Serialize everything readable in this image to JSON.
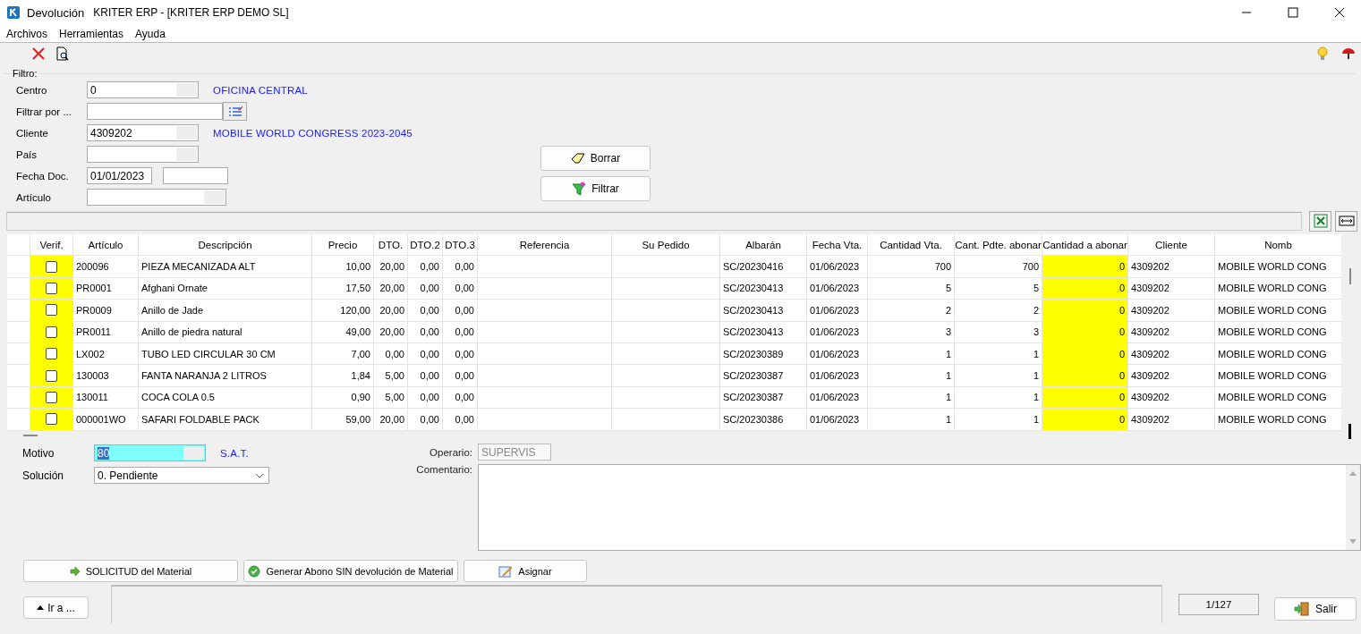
{
  "window": {
    "title": "Devolución",
    "app": "KRITER ERP -  [KRITER ERP DEMO SL]"
  },
  "menu": [
    "Archivos",
    "Herramientas",
    "Ayuda"
  ],
  "filter": {
    "title": "Filtro:",
    "fields": [
      {
        "label": "Centro",
        "kind": "lookup",
        "value": "0",
        "description": "OFICINA CENTRAL"
      },
      {
        "label": "Filtrar por ...",
        "kind": "list"
      },
      {
        "label": "Cliente",
        "kind": "lookup",
        "value": "4309202",
        "description": "MOBILE WORLD CONGRESS 2023-2045"
      },
      {
        "label": "País",
        "kind": "lookup"
      },
      {
        "label": "Fecha Doc.",
        "kind": "range",
        "value": "01/01/2023"
      },
      {
        "label": "Artículo",
        "kind": "lookup_wide"
      }
    ],
    "buttons": [
      "Borrar",
      "Filtrar"
    ]
  },
  "table": {
    "check_column": {
      "label": "Verif."
    },
    "columns": [
      {
        "label": "Artículo",
        "kind": "text"
      },
      {
        "label": "Descripción",
        "kind": "text"
      },
      {
        "label": "Precio",
        "kind": "number"
      },
      {
        "label": "DTO.",
        "kind": "number"
      },
      {
        "label": "DTO.2",
        "kind": "number"
      },
      {
        "label": "DTO.3",
        "kind": "number"
      },
      {
        "label": "Referencia",
        "kind": "text"
      },
      {
        "label": "Su Pedido",
        "kind": "text"
      },
      {
        "label": "Albarán",
        "kind": "text"
      },
      {
        "label": "Fecha Vta.",
        "kind": "text"
      },
      {
        "label": "Cantidad Vta.",
        "kind": "number"
      },
      {
        "label": "Cant. Pdte. abonar",
        "kind": "number"
      },
      {
        "label": "Cantidad a abonar",
        "kind": "editable"
      },
      {
        "label": "Cliente",
        "kind": "text"
      },
      {
        "label": "Nomb",
        "kind": "text"
      }
    ],
    "rows": [
      {
        "checked": false,
        "cells": [
          "200096",
          "PIEZA MECANIZADA ALT",
          "10,00",
          "20,00",
          "0,00",
          "0,00",
          "",
          "",
          "SC/20230416",
          "01/06/2023",
          "700",
          "700",
          "0",
          "4309202",
          "MOBILE WORLD CONG"
        ]
      },
      {
        "checked": false,
        "cells": [
          "PR0001",
          "Afghani Ornate",
          "17,50",
          "20,00",
          "0,00",
          "0,00",
          "",
          "",
          "SC/20230413",
          "01/06/2023",
          "5",
          "5",
          "0",
          "4309202",
          "MOBILE WORLD CONG"
        ]
      },
      {
        "checked": false,
        "cells": [
          "PR0009",
          "Anillo de Jade",
          "120,00",
          "20,00",
          "0,00",
          "0,00",
          "",
          "",
          "SC/20230413",
          "01/06/2023",
          "2",
          "2",
          "0",
          "4309202",
          "MOBILE WORLD CONG"
        ]
      },
      {
        "checked": false,
        "cells": [
          "PR0011",
          "Anillo de piedra natural",
          "49,00",
          "20,00",
          "0,00",
          "0,00",
          "",
          "",
          "SC/20230413",
          "01/06/2023",
          "3",
          "3",
          "0",
          "4309202",
          "MOBILE WORLD CONG"
        ]
      },
      {
        "checked": false,
        "cells": [
          "LX002",
          "TUBO LED CIRCULAR 30 CM",
          "7,00",
          "0,00",
          "0,00",
          "0,00",
          "",
          "",
          "SC/20230389",
          "01/06/2023",
          "1",
          "1",
          "0",
          "4309202",
          "MOBILE WORLD CONG"
        ]
      },
      {
        "checked": false,
        "cells": [
          "130003",
          "FANTA NARANJA 2 LITROS",
          "1,84",
          "5,00",
          "0,00",
          "0,00",
          "",
          "",
          "SC/20230387",
          "01/06/2023",
          "1",
          "1",
          "0",
          "4309202",
          "MOBILE WORLD CONG"
        ]
      },
      {
        "checked": false,
        "cells": [
          "130011",
          "COCA COLA 0.5",
          "0,90",
          "5,00",
          "0,00",
          "0,00",
          "",
          "",
          "SC/20230387",
          "01/06/2023",
          "1",
          "1",
          "0",
          "4309202",
          "MOBILE WORLD CONG"
        ]
      },
      {
        "checked": false,
        "cells": [
          "000001WO",
          "SAFARI FOLDABLE PACK",
          "59,00",
          "20,00",
          "0,00",
          "0,00",
          "",
          "",
          "SC/20230386",
          "01/06/2023",
          "1",
          "1",
          "0",
          "4309202",
          "MOBILE WORLD CONG"
        ]
      }
    ]
  },
  "motivo": {
    "label": "Motivo",
    "value": "80",
    "focused": true,
    "description": "S.A.T."
  },
  "solucion": {
    "label": "Solución",
    "value": "0. Pendiente"
  },
  "operario": {
    "label": "Operario:",
    "value": "SUPERVIS",
    "disabled": true
  },
  "comentario": {
    "label": "Comentario:"
  },
  "actions": [
    "SOLICITUD del Material",
    "Generar Abono SIN devolución de Material",
    "Asignar"
  ],
  "goto_button": "Ir a ...",
  "record_counter": "1/127",
  "exit_button": "Salir"
}
